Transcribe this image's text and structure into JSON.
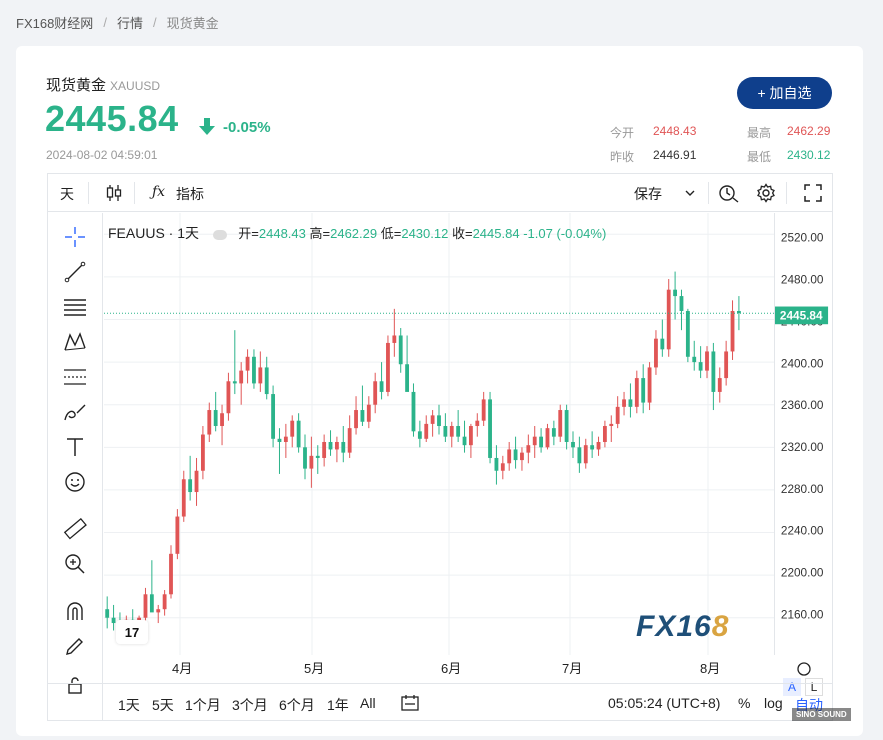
{
  "breadcrumb": {
    "site": "FX168财经网",
    "section": "行情",
    "current": "现货黄金"
  },
  "quote": {
    "name": "现货黄金",
    "code": "XAUUSD",
    "price": "2445.84",
    "change_pct": "-0.05%",
    "timestamp": "2024-08-02 04:59:01",
    "add_label": "+ 加自选",
    "open_label": "今开",
    "open": "2448.43",
    "high_label": "最高",
    "high": "2462.29",
    "prev_label": "昨收",
    "prev": "2446.91",
    "low_label": "最低",
    "low": "2430.12"
  },
  "toolbar": {
    "interval": "天",
    "indicators_label": "指标",
    "save_label": "保存"
  },
  "legend": {
    "symbol": "FEAUUS · 1天",
    "open_label": "开",
    "open": "2448.43",
    "high_label": "高",
    "high": "2462.29",
    "low_label": "低",
    "low": "2430.12",
    "close_label": "收",
    "close": "2445.84",
    "change": "-1.07 (-0.04%)"
  },
  "bottom": {
    "ranges": [
      "1天",
      "5天",
      "1个月",
      "3个月",
      "6个月",
      "1年",
      "All"
    ],
    "time": "05:05:24 (UTC+8)",
    "pct": "%",
    "log": "log",
    "auto": "自动"
  },
  "watermark": {
    "fx": "FX16",
    "eight": "8"
  },
  "tv_logo": "17",
  "axis_buttons": {
    "a": "A",
    "l": "L"
  },
  "brand_stamp": "SINO SOUND",
  "colors": {
    "up": "#e05555",
    "down": "#2bb38a",
    "brand": "#0f3f8c"
  },
  "chart_data": {
    "type": "candlestick",
    "x_labels": [
      "4月",
      "5月",
      "6月",
      "7月",
      "8月"
    ],
    "y_ticks": [
      2160,
      2200,
      2240,
      2280,
      2320,
      2360,
      2400,
      2440,
      2480,
      2520
    ],
    "ylim": [
      2125,
      2540
    ],
    "last_price": "2445.84",
    "candles": [
      [
        2168,
        2180,
        2150,
        2160
      ],
      [
        2160,
        2172,
        2148,
        2155
      ],
      [
        2155,
        2165,
        2140,
        2150
      ],
      [
        2150,
        2162,
        2145,
        2158
      ],
      [
        2158,
        2168,
        2150,
        2153
      ],
      [
        2153,
        2162,
        2145,
        2160
      ],
      [
        2160,
        2188,
        2155,
        2182
      ],
      [
        2182,
        2214,
        2175,
        2165
      ],
      [
        2165,
        2172,
        2155,
        2168
      ],
      [
        2168,
        2186,
        2162,
        2182
      ],
      [
        2182,
        2228,
        2178,
        2220
      ],
      [
        2220,
        2262,
        2215,
        2255
      ],
      [
        2255,
        2298,
        2250,
        2290
      ],
      [
        2290,
        2312,
        2270,
        2278
      ],
      [
        2278,
        2310,
        2265,
        2298
      ],
      [
        2298,
        2340,
        2290,
        2332
      ],
      [
        2332,
        2362,
        2325,
        2355
      ],
      [
        2355,
        2372,
        2335,
        2340
      ],
      [
        2340,
        2360,
        2322,
        2352
      ],
      [
        2352,
        2390,
        2345,
        2382
      ],
      [
        2382,
        2430,
        2370,
        2380
      ],
      [
        2380,
        2400,
        2360,
        2392
      ],
      [
        2392,
        2412,
        2380,
        2405
      ],
      [
        2405,
        2412,
        2375,
        2380
      ],
      [
        2380,
        2410,
        2372,
        2395
      ],
      [
        2395,
        2405,
        2365,
        2370
      ],
      [
        2370,
        2378,
        2320,
        2328
      ],
      [
        2328,
        2338,
        2295,
        2325
      ],
      [
        2325,
        2342,
        2310,
        2330
      ],
      [
        2330,
        2350,
        2320,
        2345
      ],
      [
        2345,
        2352,
        2315,
        2320
      ],
      [
        2320,
        2332,
        2290,
        2300
      ],
      [
        2300,
        2330,
        2282,
        2312
      ],
      [
        2312,
        2322,
        2295,
        2310
      ],
      [
        2310,
        2332,
        2302,
        2325
      ],
      [
        2325,
        2336,
        2312,
        2318
      ],
      [
        2318,
        2330,
        2306,
        2325
      ],
      [
        2325,
        2340,
        2306,
        2315
      ],
      [
        2315,
        2350,
        2310,
        2338
      ],
      [
        2338,
        2368,
        2332,
        2355
      ],
      [
        2355,
        2378,
        2340,
        2344
      ],
      [
        2344,
        2368,
        2338,
        2360
      ],
      [
        2360,
        2390,
        2352,
        2382
      ],
      [
        2382,
        2400,
        2365,
        2372
      ],
      [
        2372,
        2425,
        2368,
        2418
      ],
      [
        2418,
        2450,
        2405,
        2425
      ],
      [
        2425,
        2432,
        2390,
        2398
      ],
      [
        2398,
        2425,
        2380,
        2372
      ],
      [
        2372,
        2380,
        2330,
        2335
      ],
      [
        2335,
        2345,
        2320,
        2328
      ],
      [
        2328,
        2350,
        2325,
        2342
      ],
      [
        2342,
        2355,
        2330,
        2350
      ],
      [
        2350,
        2360,
        2332,
        2340
      ],
      [
        2340,
        2352,
        2325,
        2330
      ],
      [
        2330,
        2344,
        2320,
        2340
      ],
      [
        2340,
        2355,
        2325,
        2330
      ],
      [
        2330,
        2345,
        2315,
        2322
      ],
      [
        2322,
        2342,
        2310,
        2340
      ],
      [
        2340,
        2352,
        2330,
        2345
      ],
      [
        2345,
        2372,
        2340,
        2365
      ],
      [
        2365,
        2372,
        2305,
        2310
      ],
      [
        2310,
        2322,
        2285,
        2298
      ],
      [
        2298,
        2312,
        2290,
        2305
      ],
      [
        2305,
        2325,
        2298,
        2318
      ],
      [
        2318,
        2330,
        2300,
        2308
      ],
      [
        2308,
        2320,
        2298,
        2315
      ],
      [
        2315,
        2332,
        2305,
        2322
      ],
      [
        2322,
        2340,
        2310,
        2330
      ],
      [
        2330,
        2338,
        2315,
        2320
      ],
      [
        2320,
        2342,
        2318,
        2338
      ],
      [
        2338,
        2345,
        2322,
        2330
      ],
      [
        2330,
        2360,
        2325,
        2355
      ],
      [
        2355,
        2360,
        2318,
        2325
      ],
      [
        2325,
        2335,
        2310,
        2320
      ],
      [
        2320,
        2330,
        2296,
        2305
      ],
      [
        2305,
        2328,
        2300,
        2322
      ],
      [
        2322,
        2335,
        2310,
        2318
      ],
      [
        2318,
        2330,
        2312,
        2325
      ],
      [
        2325,
        2345,
        2320,
        2340
      ],
      [
        2340,
        2350,
        2325,
        2342
      ],
      [
        2342,
        2368,
        2338,
        2358
      ],
      [
        2358,
        2372,
        2350,
        2365
      ],
      [
        2365,
        2380,
        2348,
        2358
      ],
      [
        2358,
        2392,
        2352,
        2385
      ],
      [
        2385,
        2398,
        2352,
        2362
      ],
      [
        2362,
        2400,
        2355,
        2395
      ],
      [
        2395,
        2430,
        2388,
        2422
      ],
      [
        2422,
        2440,
        2405,
        2412
      ],
      [
        2412,
        2478,
        2405,
        2468
      ],
      [
        2468,
        2485,
        2440,
        2462
      ],
      [
        2462,
        2468,
        2430,
        2448
      ],
      [
        2448,
        2450,
        2400,
        2405
      ],
      [
        2405,
        2420,
        2392,
        2400
      ],
      [
        2400,
        2415,
        2385,
        2392
      ],
      [
        2392,
        2415,
        2385,
        2410
      ],
      [
        2410,
        2418,
        2355,
        2372
      ],
      [
        2372,
        2395,
        2362,
        2385
      ],
      [
        2385,
        2420,
        2378,
        2410
      ],
      [
        2410,
        2458,
        2402,
        2448
      ],
      [
        2448,
        2462,
        2430,
        2446
      ]
    ]
  }
}
